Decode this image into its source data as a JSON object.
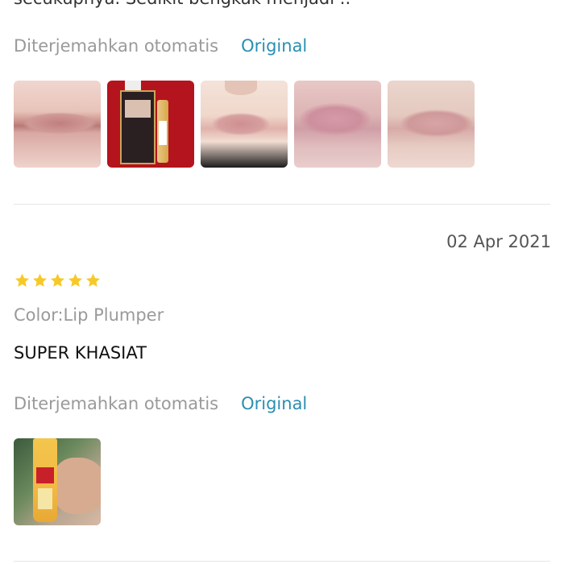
{
  "previous_review": {
    "cut_text": "secukupnya. Sedikit bengkak menjadi .."
  },
  "translation": {
    "auto_label": "Diterjemahkan otomatis",
    "original_label": "Original"
  },
  "review": {
    "date": "02 Apr 2021",
    "rating": 5,
    "variant": "Color:Lip Plumper",
    "text": "SUPER KHASIAT"
  },
  "colors": {
    "star": "#f7c928",
    "link": "#2a8fb0",
    "muted": "#9a9a9a"
  }
}
